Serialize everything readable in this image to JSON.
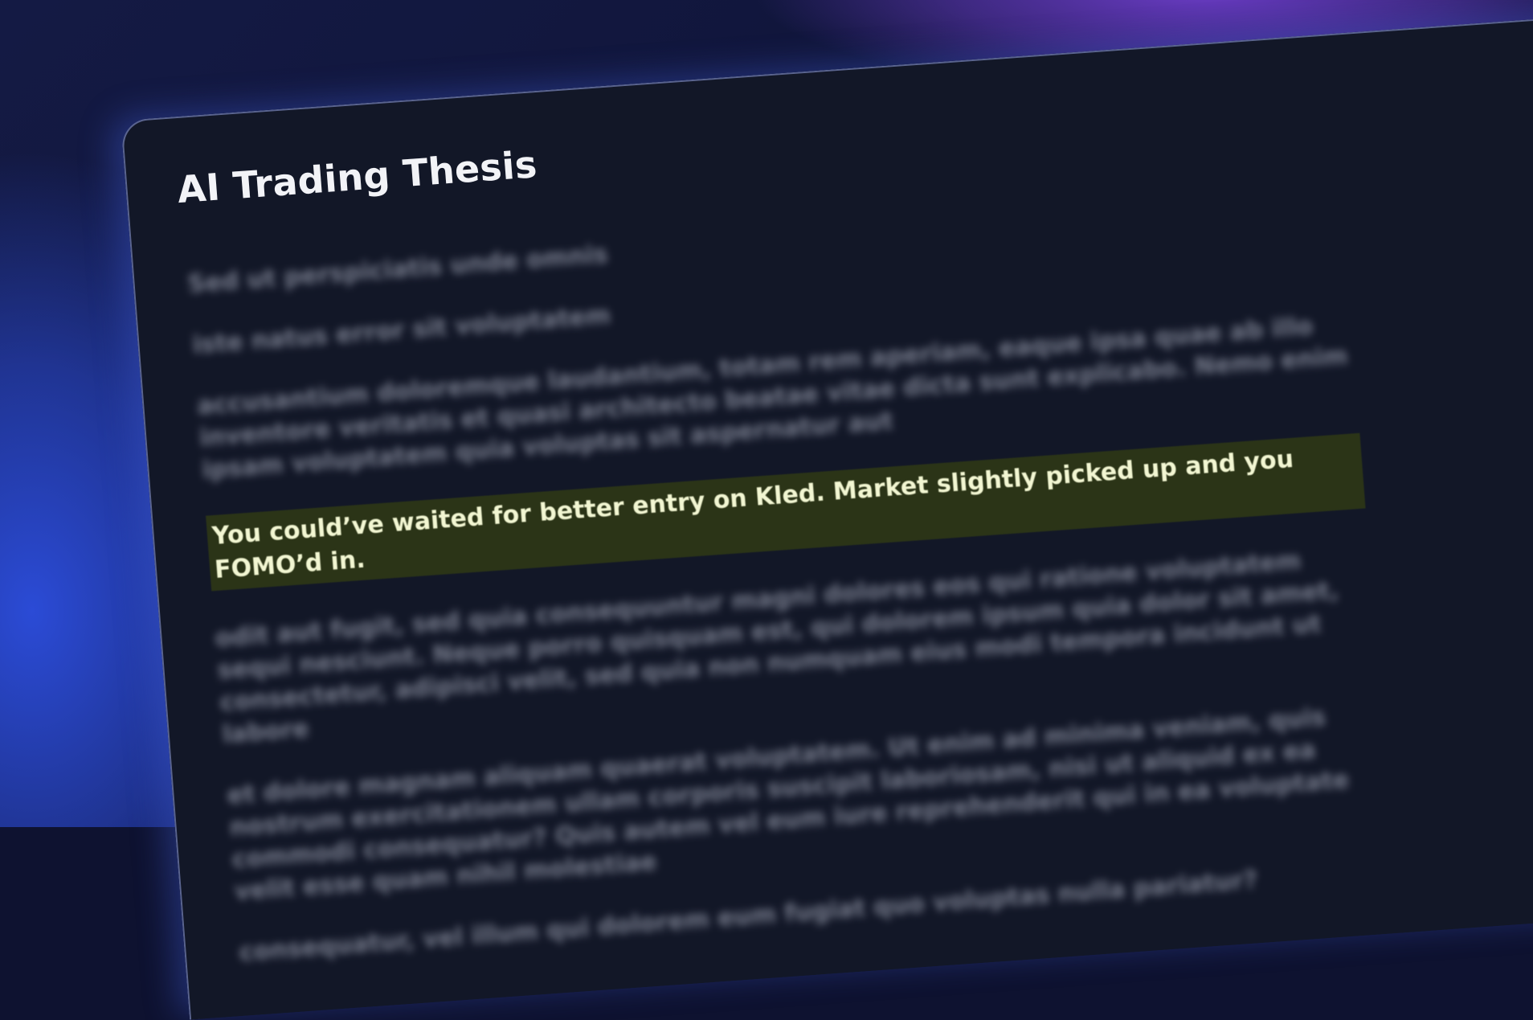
{
  "document": {
    "title": "AI Trading Thesis",
    "paragraphs": [
      "Sed ut perspiciatis unde omnis",
      "iste natus error sit voluptatem",
      "accusantium doloremque laudantium, totam rem aperiam, eaque ipsa quae ab illo inventore veritatis et quasi architecto beatae vitae dicta sunt explicabo. Nemo enim ipsam voluptatem quia voluptas sit aspernatur aut",
      "odit aut fugit, sed quia consequuntur magni dolores eos qui ratione voluptatem sequi nesciunt. Neque porro quisquam est, qui dolorem ipsum quia dolor sit amet, consectetur, adipisci velit, sed quia non numquam eius modi tempora incidunt ut labore",
      "et dolore magnam aliquam quaerat voluptatem. Ut enim ad minima veniam, quis nostrum exercitationem ullam corporis suscipit laboriosam, nisi ut aliquid ex ea commodi consequatur? Quis autem vel eum iure reprehenderit qui in ea voluptate velit esse quam nihil molestiae",
      "consequatur, vel illum qui dolorem eum fugiat quo voluptas nulla pariatur?"
    ],
    "highlighted_sentence": "You could’ve waited for better entry on Kled. Market slightly picked up and you FOMO’d in."
  }
}
